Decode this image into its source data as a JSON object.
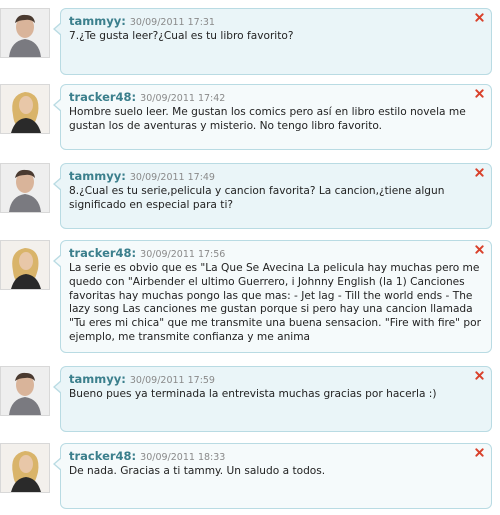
{
  "comments": [
    {
      "user": "tammyy:",
      "date": "30/09/2011 17:31",
      "text": "7.¿Te gusta leer?¿Cual es tu libro favorito?",
      "avatar_icon": "male-user-avatar"
    },
    {
      "user": "tracker48:",
      "date": "30/09/2011 17:42",
      "text": "Hombre suelo leer. Me gustan los comics pero así en libro estilo novela me gustan los de aventuras y misterio. No tengo libro favorito.",
      "avatar_icon": "female-user-avatar"
    },
    {
      "user": "tammyy:",
      "date": "30/09/2011 17:49",
      "text": "8.¿Cual es tu serie,pelicula y cancion favorita? La cancion,¿tiene algun significado en especial para ti?",
      "avatar_icon": "male-user-avatar"
    },
    {
      "user": "tracker48:",
      "date": "30/09/2011 17:56",
      "text": "La serie es obvio que es \"La Que Se Avecina La pelicula hay muchas pero me quedo con \"Airbender el ultimo Guerrero, i Johnny English (la 1) Canciones favoritas hay muchas pongo las que mas: - Jet lag - Till the world ends - The lazy song Las canciones me gustan porque si pero hay una cancion llamada \"Tu eres mi chica\" que me transmite una buena sensacion. \"Fire with fire\" por ejemplo, me transmite confianza y me anima",
      "avatar_icon": "female-user-avatar"
    },
    {
      "user": "tammyy:",
      "date": "30/09/2011 17:59",
      "text": "Bueno pues ya terminada la entrevista muchas gracias por hacerla :)",
      "avatar_icon": "male-user-avatar"
    },
    {
      "user": "tracker48:",
      "date": "30/09/2011 18:33",
      "text": "De nada. Gracias a ti tammy. Un saludo a todos.",
      "avatar_icon": "female-user-avatar"
    }
  ],
  "delete_icon": "close-icon",
  "colors": {
    "username": "#3b7f8c",
    "bubble_border": "#b9dbe3",
    "bubble_bg_blue": "#eaf5f8",
    "delete_red": "#d9412b"
  }
}
